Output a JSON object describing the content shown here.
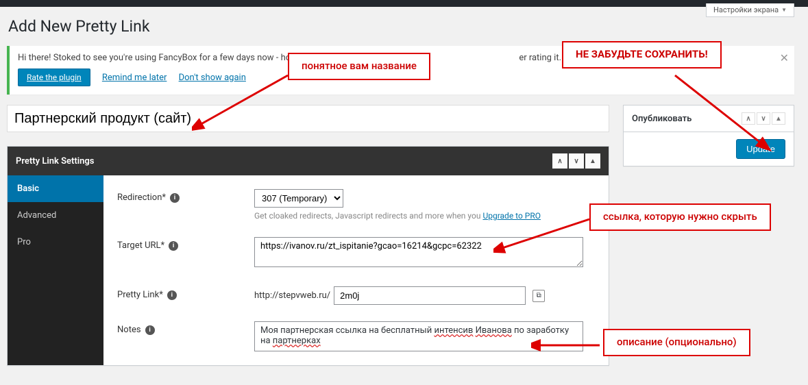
{
  "screen_options": "Настройки экрана",
  "page_title": "Add New Pretty Link",
  "notice": {
    "text_before": "Hi there! Stoked to see you're using FancyBox for a few days now - hope y",
    "text_after": "er rating it. It would mean the world to u",
    "rate_button": "Rate the plugin",
    "remind_later": "Remind me later",
    "dont_show": "Don't show again"
  },
  "title_input_value": "Партнерский продукт (сайт)",
  "settings_panel_title": "Pretty Link Settings",
  "tabs": {
    "basic": "Basic",
    "advanced": "Advanced",
    "pro": "Pro"
  },
  "fields": {
    "redirection": {
      "label": "Redirection*",
      "select_value": "307 (Temporary)",
      "helper": "Get cloaked redirects, Javascript redirects and more when you ",
      "helper_link": "Upgrade to PRO"
    },
    "target_url": {
      "label": "Target URL*",
      "value": "https://ivanov.ru/zt_ispitanie?gcao=16214&gcpc=62322"
    },
    "pretty_link": {
      "label": "Pretty Link*",
      "prefix": "http://stepvweb.ru/",
      "slug": "2m0j"
    },
    "notes": {
      "label": "Notes",
      "value_p1": "Моя партнерская ссылка на бесплатный ",
      "value_w1": "интенсив",
      "value_sp": " ",
      "value_w2": "Иванова",
      "value_p2": " по заработку на ",
      "value_w3": "партнерках"
    }
  },
  "publish": {
    "title": "Опубликовать",
    "button": "Update"
  },
  "annotations": {
    "title_note": "понятное вам название",
    "save_note": "НЕ ЗАБУДЬТЕ СОХРАНИТЬ!",
    "link_note": "ссылка, которую нужно скрыть",
    "desc_note": "описание (опционально)"
  }
}
